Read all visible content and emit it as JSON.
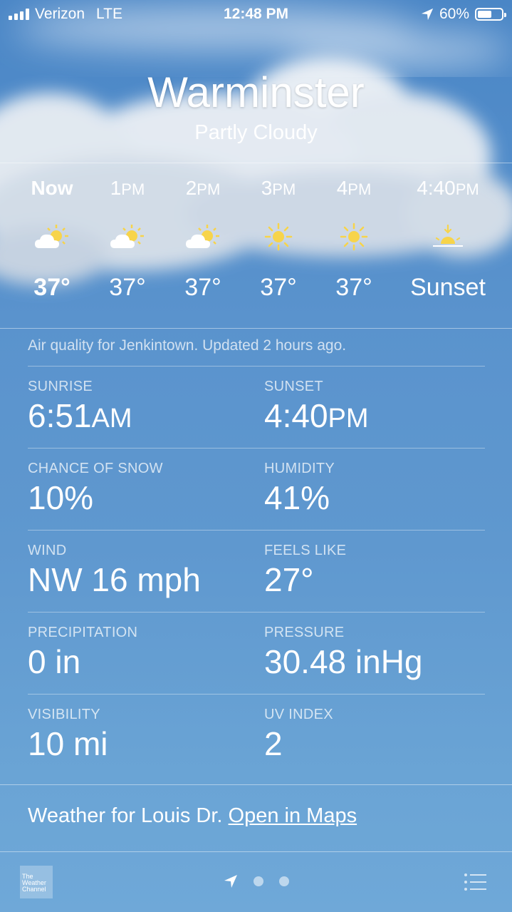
{
  "status_bar": {
    "carrier": "Verizon",
    "network": "LTE",
    "time": "12:48 PM",
    "battery": "60%",
    "battery_level": 0.6
  },
  "location": {
    "city": "Warminster",
    "condition": "Partly Cloudy"
  },
  "hourly": [
    {
      "time": "Now",
      "ampm": "",
      "icon": "partly-cloudy-icon",
      "temp": "37°"
    },
    {
      "time": "1",
      "ampm": "PM",
      "icon": "partly-cloudy-icon",
      "temp": "37°"
    },
    {
      "time": "2",
      "ampm": "PM",
      "icon": "partly-cloudy-icon",
      "temp": "37°"
    },
    {
      "time": "3",
      "ampm": "PM",
      "icon": "sun-icon",
      "temp": "37°"
    },
    {
      "time": "4",
      "ampm": "PM",
      "icon": "sun-icon",
      "temp": "37°"
    },
    {
      "time": "4:40",
      "ampm": "PM",
      "icon": "sunset-icon",
      "temp": "Sunset"
    }
  ],
  "air_quality_note": "Air quality for Jenkintown. Updated 2 hours ago.",
  "details": [
    {
      "left": {
        "label": "SUNRISE",
        "value": "6:51",
        "suffix": "AM"
      },
      "right": {
        "label": "SUNSET",
        "value": "4:40",
        "suffix": "PM"
      }
    },
    {
      "left": {
        "label": "CHANCE OF SNOW",
        "value": "10%",
        "suffix": ""
      },
      "right": {
        "label": "HUMIDITY",
        "value": "41%",
        "suffix": ""
      }
    },
    {
      "left": {
        "label": "WIND",
        "value": "NW 16 mph",
        "suffix": ""
      },
      "right": {
        "label": "FEELS LIKE",
        "value": "27°",
        "suffix": ""
      }
    },
    {
      "left": {
        "label": "PRECIPITATION",
        "value": "0 in",
        "suffix": ""
      },
      "right": {
        "label": "PRESSURE",
        "value": "30.48 inHg",
        "suffix": ""
      }
    },
    {
      "left": {
        "label": "VISIBILITY",
        "value": "10 mi",
        "suffix": ""
      },
      "right": {
        "label": "UV INDEX",
        "value": "2",
        "suffix": ""
      }
    }
  ],
  "footer": {
    "text": "Weather for Louis Dr.",
    "link": "Open in Maps"
  },
  "bottom_bar": {
    "logo_lines": [
      "The",
      "Weather",
      "Channel"
    ],
    "page_icon": "location-arrow-icon",
    "menu_icon": "list-icon"
  },
  "colors": {
    "sun": "#f7d44a",
    "sky_top": "#4a86c6",
    "sky_bottom": "#6fa8d8"
  }
}
